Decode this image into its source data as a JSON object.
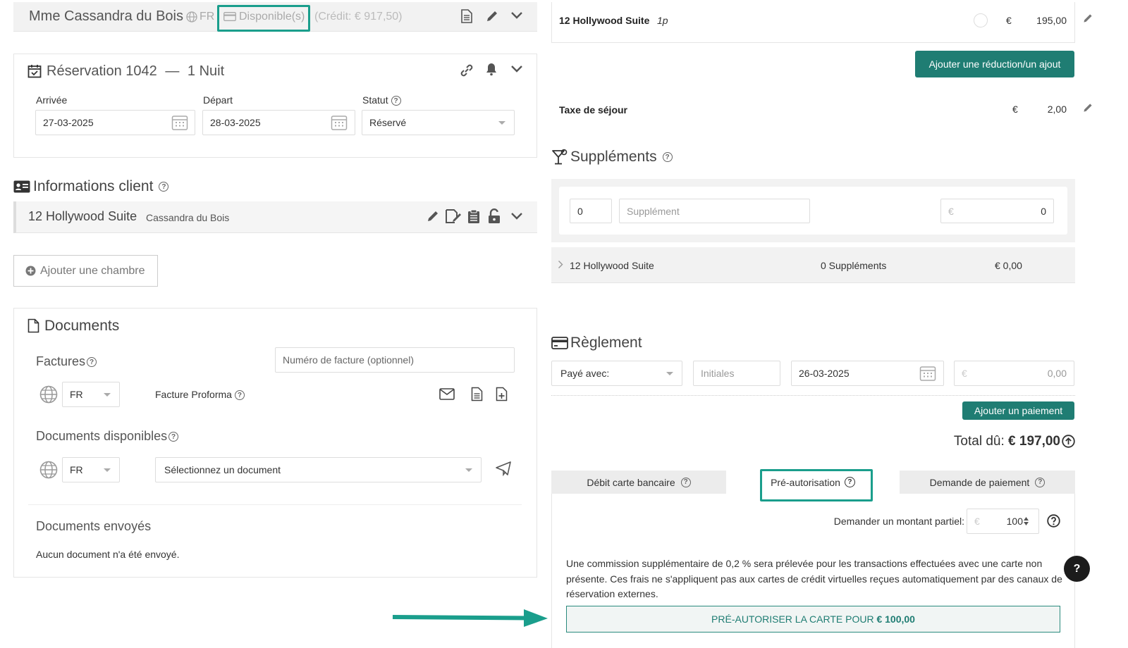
{
  "guest_bar": {
    "name": "Mme Cassandra du Bois",
    "lang": "FR",
    "card_status": "Disponible(s)",
    "credit": "(Crédit: € 917,50)"
  },
  "reservation": {
    "title": "Réservation 1042",
    "sep": "—",
    "nights": "1 Nuit",
    "arrival_label": "Arrivée",
    "arrival_value": "27-03-2025",
    "departure_label": "Départ",
    "departure_value": "28-03-2025",
    "status_label": "Statut",
    "status_value": "Réservé"
  },
  "client_info": {
    "heading": "Informations client",
    "room": "12 Hollywood Suite",
    "guest": "Cassandra du Bois"
  },
  "add_room": "Ajouter une chambre",
  "documents": {
    "heading": "Documents",
    "invoices_label": "Factures",
    "invoice_number_placeholder": "Numéro de facture (optionnel)",
    "invoice_lang": "FR",
    "proforma_label": "Facture Proforma",
    "available_label": "Documents disponibles",
    "available_lang": "FR",
    "select_doc": "Sélectionnez un document",
    "sent_label": "Documents envoyés",
    "none_sent": "Aucun document n'a été envoyé."
  },
  "right": {
    "room_line": {
      "name": "12 Hollywood Suite",
      "persons": "1p",
      "currency": "€",
      "amount": "195,00"
    },
    "add_discount": "Ajouter une réduction/un ajout",
    "tax": {
      "label": "Taxe de séjour",
      "currency": "€",
      "amount": "2,00"
    },
    "supplements": {
      "heading": "Suppléments",
      "qty": "0",
      "name_placeholder": "Supplément",
      "currency": "€",
      "price": "0",
      "row_room": "12 Hollywood Suite",
      "row_count": "0 Suppléments",
      "row_total": "€ 0,00"
    },
    "payment": {
      "heading": "Règlement",
      "paid_with": "Payé avec:",
      "initials_placeholder": "Initiales",
      "date": "26-03-2025",
      "currency": "€",
      "amount": "0,00",
      "add_payment": "Ajouter un paiement",
      "total_label": "Total dû:",
      "total_value": "€ 197,00"
    },
    "tabs": [
      "Débit carte bancaire",
      "Pré-autorisation",
      "Demande de paiement"
    ],
    "partial_label": "Demander un montant partiel:",
    "partial_currency": "€",
    "partial_value": "100",
    "notice": "Une commission supplémentaire de 0,2 % sera prélevée pour les transactions effectuées avec une carte non présente. Ces frais ne s'appliquent pas aux cartes de crédit virtuelles reçues automatiquement par des canaux de réservation externes.",
    "preauth_prefix": "PRÉ-AUTORISER LA CARTE POUR",
    "preauth_amount": "€ 100,00"
  },
  "help_button": "?",
  "colors": {
    "teal": "#1f7d73",
    "highlight": "#1a9e8c"
  }
}
